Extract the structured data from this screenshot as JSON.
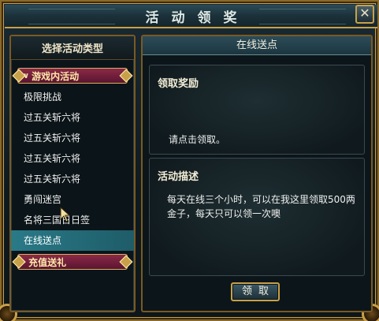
{
  "window": {
    "title": "活动领奖",
    "close_label": "✕"
  },
  "left_panel": {
    "header": "选择活动类型",
    "category_ingame": "游戏内活动",
    "category_ingame_arrow": "∨",
    "items": [
      {
        "label": "极限挑战",
        "selected": false
      },
      {
        "label": "过五关斩六将",
        "selected": false
      },
      {
        "label": "过五关斩六将",
        "selected": false
      },
      {
        "label": "过五关斩六将",
        "selected": false
      },
      {
        "label": "过五关斩六将",
        "selected": false
      },
      {
        "label": "勇闯迷宫",
        "selected": false
      },
      {
        "label": "名将三国日日签",
        "selected": false
      },
      {
        "label": "在线送点",
        "selected": true
      }
    ],
    "category_recharge": "充值送礼"
  },
  "right_panel": {
    "header": "在线送点",
    "reward_title": "领取奖励",
    "reward_text": "请点击领取。",
    "desc_title": "活动描述",
    "desc_text": "每天在线三个小时，可以在我这里领取500两金子，每天只可以领一次噢",
    "claim_button": "领取"
  },
  "colors": {
    "accent_gold": "#c9a04a",
    "selected_row": "#2a7a88",
    "category_tab": "#8a2a48"
  }
}
